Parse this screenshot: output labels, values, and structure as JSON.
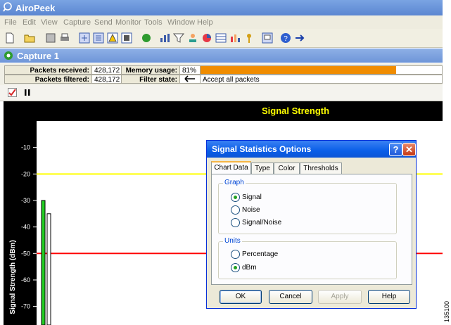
{
  "app": {
    "title": "AiroPeek"
  },
  "menu": [
    "File",
    "Edit",
    "View",
    "Capture",
    "Send",
    "Monitor",
    "Tools",
    "Window",
    "Help"
  ],
  "capture": {
    "title": "Capture 1"
  },
  "stats": {
    "packets_received_label": "Packets received:",
    "packets_received": "428,172",
    "packets_filtered_label": "Packets filtered:",
    "packets_filtered": "428,172",
    "memory_usage_label": "Memory usage:",
    "memory_usage": "81%",
    "memory_usage_fraction": 0.81,
    "filter_state_label": "Filter state:",
    "filter_state_icon": "left-arrow-icon",
    "filter_state": "Accept all packets"
  },
  "chart_toolbar": {
    "icons": [
      "checkmark-options-icon",
      "pause-icon"
    ]
  },
  "chart_data": {
    "type": "bar",
    "title": "Signal Strength",
    "ylabel": "Signal Strength (dBm)",
    "y_ticks": [
      "-10",
      "-20",
      "-30",
      "-40",
      "-50",
      "-60",
      "-70"
    ],
    "ylim": [
      -77,
      0
    ],
    "bars": [
      {
        "value": -30,
        "color": "#22cc22"
      },
      {
        "value": -35,
        "color": "#ffffff"
      }
    ],
    "threshold_lines": [
      {
        "value": -20,
        "color": "#ffff00"
      },
      {
        "value": -50,
        "color": "#ff0000"
      }
    ]
  },
  "dialog": {
    "title": "Signal Statistics Options",
    "help_glyph": "?",
    "close_glyph": "✕",
    "tabs": [
      "Chart Data",
      "Type",
      "Color",
      "Thresholds"
    ],
    "graph_group": "Graph",
    "graph_options": [
      {
        "label": "Signal",
        "checked": true
      },
      {
        "label": "Noise",
        "checked": false
      },
      {
        "label": "Signal/Noise",
        "checked": false
      }
    ],
    "units_group": "Units",
    "units_options": [
      {
        "label": "Percentage",
        "checked": false
      },
      {
        "label": "dBm",
        "checked": true
      }
    ],
    "buttons": {
      "ok": "OK",
      "cancel": "Cancel",
      "apply": "Apply",
      "help": "Help"
    }
  },
  "figure_number": "135100",
  "colors": {
    "chart_title": "#ffff00",
    "memory_bar": "#f08c00",
    "dialog_title": "#0a5ee8"
  }
}
